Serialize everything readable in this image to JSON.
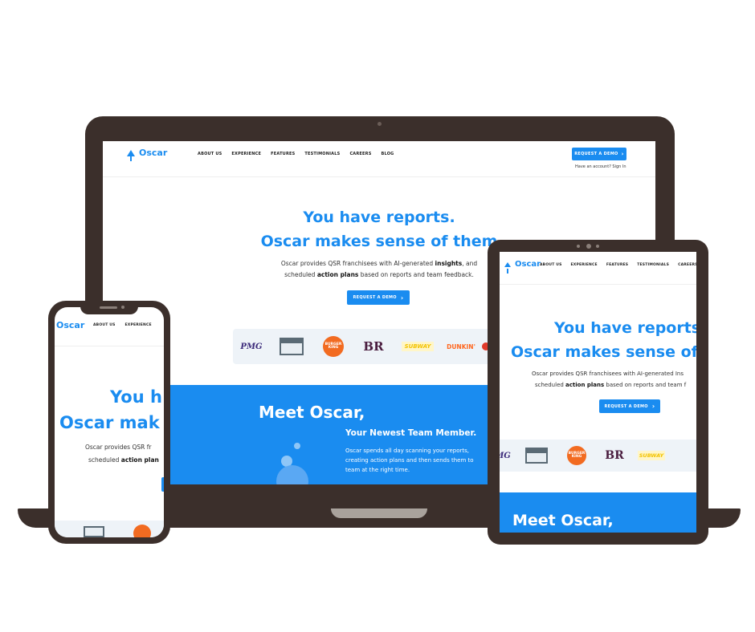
{
  "brand": {
    "name": "Oscar"
  },
  "nav": {
    "items": [
      "ABOUT US",
      "EXPERIENCE",
      "FEATURES",
      "TESTIMONIALS",
      "CAREERS",
      "BLOG"
    ]
  },
  "header": {
    "demo_label": "REQUEST A DEMO",
    "account_prompt": "Have an account? Sign In"
  },
  "hero": {
    "title_line1": "You have reports.",
    "title_line2": "Oscar makes sense of them",
    "sub_part1": "Oscar provides QSR franchisees with AI-generated ",
    "sub_bold1": "insights",
    "sub_part2": ", and",
    "sub_part3": "scheduled ",
    "sub_bold2": "action plans",
    "sub_part4": " based on reports and team feedback.",
    "demo_label": "REQUEST A DEMO"
  },
  "brands": [
    "PMG",
    "THE UPS STORE",
    "BURGER KING",
    "BR",
    "SUBWAY",
    "DUNKIN'"
  ],
  "meet": {
    "title": "Meet Oscar,",
    "subtitle": "Your Newest Team Member.",
    "body_line1": "Oscar spends all day scanning your reports,",
    "body_line2": "creating action plans and then sends them to",
    "body_line3": "team at the right time."
  },
  "tablet": {
    "title_line1": "You have reports",
    "title_line2": "Oscar makes sense of",
    "sub_line1": "Oscar provides QSR franchisees with AI-generated Ins",
    "sub_part3": "scheduled ",
    "sub_bold2": "action plans",
    "sub_part4": " based on reports and team f"
  },
  "phone": {
    "title_line1": "You h",
    "title_line2": "Oscar mak",
    "sub_line1": "Oscar provides QSR fr",
    "sub_part3": "scheduled ",
    "sub_bold2": "action plan"
  },
  "colors": {
    "accent": "#1a8cf0",
    "device": "#3b2f2b"
  }
}
